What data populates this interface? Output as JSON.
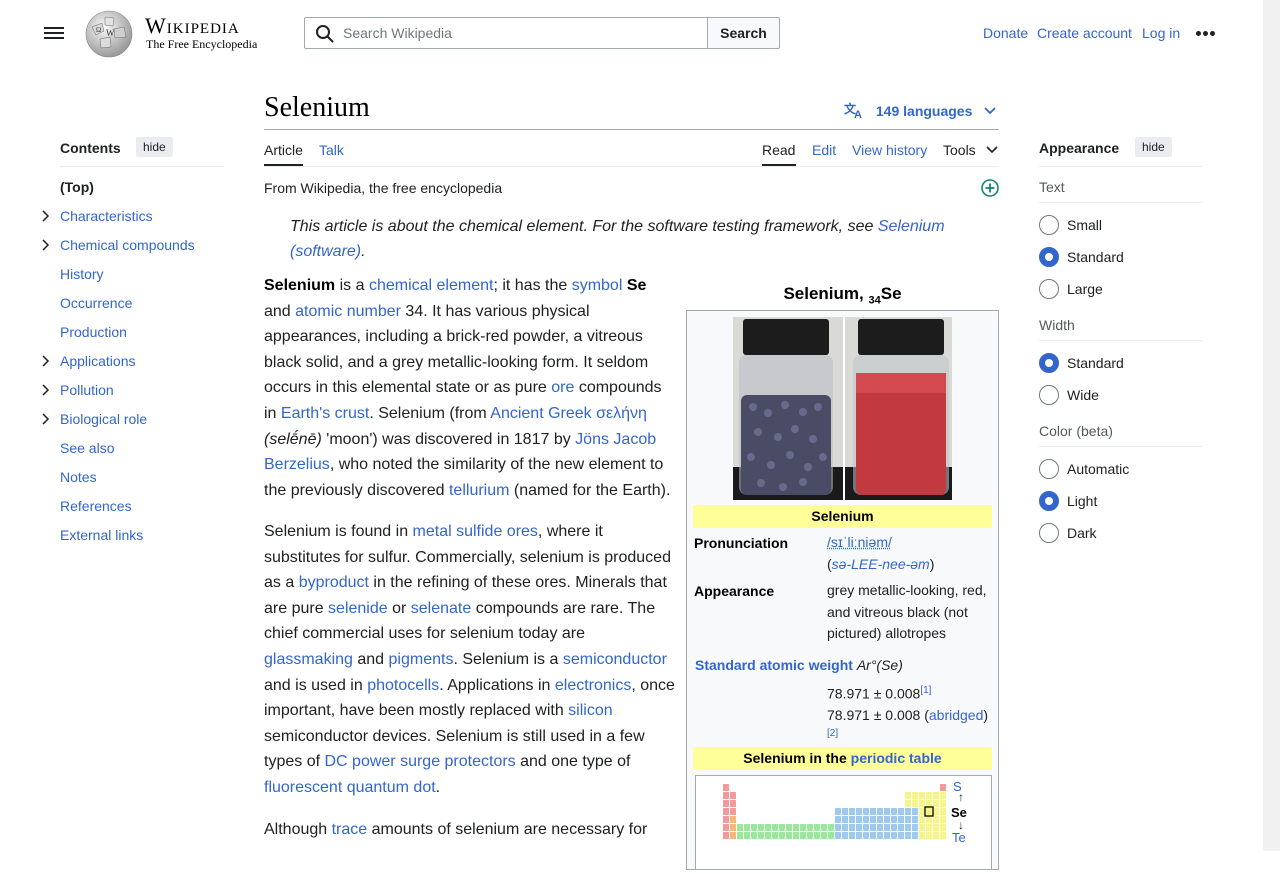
{
  "header": {
    "wordmark": "Wikipedia",
    "tagline": "The Free Encyclopedia",
    "search_placeholder": "Search Wikipedia",
    "search_button": "Search",
    "donate": "Donate",
    "create_account": "Create account",
    "log_in": "Log in"
  },
  "page": {
    "title": "Selenium",
    "languages": "149 languages",
    "tabs": {
      "article": "Article",
      "talk": "Talk",
      "read": "Read",
      "edit": "Edit",
      "history": "View history",
      "tools": "Tools"
    },
    "from": "From Wikipedia, the free encyclopedia"
  },
  "toc": {
    "title": "Contents",
    "hide": "hide",
    "items": [
      {
        "label": "(Top)"
      },
      {
        "label": "Characteristics"
      },
      {
        "label": "Chemical compounds"
      },
      {
        "label": "History"
      },
      {
        "label": "Occurrence"
      },
      {
        "label": "Production"
      },
      {
        "label": "Applications"
      },
      {
        "label": "Pollution"
      },
      {
        "label": "Biological role"
      },
      {
        "label": "See also"
      },
      {
        "label": "Notes"
      },
      {
        "label": "References"
      },
      {
        "label": "External links"
      }
    ]
  },
  "hatnote": {
    "text": "This article is about the chemical element. For the software testing framework, see ",
    "link": "Selenium (software)",
    "end": "."
  },
  "paragraphs": {
    "p1": [
      {
        "t": "Selenium",
        "b": true
      },
      {
        "t": " is a "
      },
      {
        "t": "chemical element",
        "a": true
      },
      {
        "t": "; it has the "
      },
      {
        "t": "symbol",
        "a": true
      },
      {
        "t": " "
      },
      {
        "t": "Se",
        "b": true
      },
      {
        "t": " and "
      },
      {
        "t": "atomic number",
        "a": true
      },
      {
        "t": " 34. It has various physical appearances, including a brick-red powder, a vitreous black solid, and a grey metallic-looking form. It seldom occurs in this elemental state or as pure "
      },
      {
        "t": "ore",
        "a": true
      },
      {
        "t": " compounds in "
      },
      {
        "t": "Earth's crust",
        "a": true
      },
      {
        "t": ". Selenium (from "
      },
      {
        "t": "Ancient Greek",
        "a": true
      },
      {
        "t": " "
      },
      {
        "t": "σελήνη",
        "a": true
      },
      {
        "t": " "
      },
      {
        "t": "(selḗnē)",
        "i": true
      },
      {
        "t": " 'moon') was discovered in 1817 by "
      },
      {
        "t": "Jöns Jacob Berzelius",
        "a": true
      },
      {
        "t": ", who noted the similarity of the new element to the previously discovered "
      },
      {
        "t": "tellurium",
        "a": true
      },
      {
        "t": " (named for the Earth)."
      }
    ],
    "p2": [
      {
        "t": "Selenium is found in "
      },
      {
        "t": "metal sulfide ores",
        "a": true
      },
      {
        "t": ", where it substitutes for sulfur. Commercially, selenium is produced as a "
      },
      {
        "t": "byproduct",
        "a": true
      },
      {
        "t": " in the refining of these ores. Minerals that are pure "
      },
      {
        "t": "selenide",
        "a": true
      },
      {
        "t": " or "
      },
      {
        "t": "selenate",
        "a": true
      },
      {
        "t": " compounds are rare. The chief commercial uses for selenium today are "
      },
      {
        "t": "glassmaking",
        "a": true
      },
      {
        "t": " and "
      },
      {
        "t": "pigments",
        "a": true
      },
      {
        "t": ". Selenium is a "
      },
      {
        "t": "semiconductor",
        "a": true
      },
      {
        "t": " and is used in "
      },
      {
        "t": "photocells",
        "a": true
      },
      {
        "t": ". Applications in "
      },
      {
        "t": "electronics",
        "a": true
      },
      {
        "t": ", once important, have been mostly replaced with "
      },
      {
        "t": "silicon",
        "a": true
      },
      {
        "t": " semiconductor devices. Selenium is still used in a few types of "
      },
      {
        "t": "DC power surge protectors",
        "a": true
      },
      {
        "t": " and one type of "
      },
      {
        "t": "fluorescent quantum dot",
        "a": true
      },
      {
        "t": "."
      }
    ],
    "p3": [
      {
        "t": "Although "
      },
      {
        "t": "trace",
        "a": true
      },
      {
        "t": " amounts of selenium are necessary for"
      }
    ]
  },
  "infobox": {
    "title_main": "Selenium, ",
    "title_sub": "34",
    "title_sym": "Se",
    "band_name": "Selenium",
    "pron_label": "Pronunciation",
    "pron_ipa": "/sɪˈliːniəm/",
    "pron_respell": "sə-LEE-nee-əm",
    "appearance_label": "Appearance",
    "appearance_value": "grey metallic-looking, red, and vitreous black (not pictured) allotropes",
    "saw_label": "Standard atomic weight",
    "saw_symbol": "Ar°(Se)",
    "saw_value1": "78.971 ± 0.008",
    "ref1": "[1]",
    "saw_value2": "78.971 ± 0.008 (",
    "abridged": "abridged",
    "ref2": "[2]",
    "pt_band_prefix": "Selenium in the ",
    "pt_band_link": "periodic table",
    "pt_above": "S",
    "pt_self": "Se",
    "pt_below": "Te",
    "colors": {
      "band": "#ffff99"
    }
  },
  "appearance": {
    "title": "Appearance",
    "hide": "hide",
    "text_label": "Text",
    "text_options": [
      "Small",
      "Standard",
      "Large"
    ],
    "width_label": "Width",
    "width_options": [
      "Standard",
      "Wide"
    ],
    "color_label": "Color (beta)",
    "color_options": [
      "Automatic",
      "Light",
      "Dark"
    ],
    "selected_text": "Standard",
    "selected_width": "Standard",
    "selected_color": "Light"
  },
  "colors": {
    "link": "#3366cc",
    "text": "#202122",
    "rule": "#a2a9b1"
  }
}
